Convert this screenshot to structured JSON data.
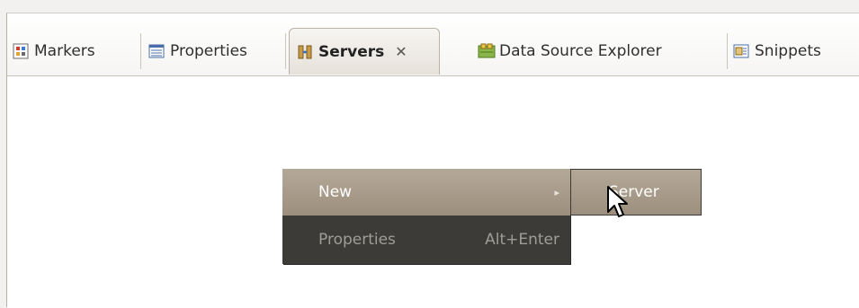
{
  "tabs": [
    {
      "label": "Markers",
      "icon": "markers-icon"
    },
    {
      "label": "Properties",
      "icon": "properties-icon"
    },
    {
      "label": "Servers",
      "icon": "servers-icon",
      "active": true,
      "close": "✕"
    },
    {
      "label": "Data Source Explorer",
      "icon": "data-source-explorer-icon"
    },
    {
      "label": "Snippets",
      "icon": "snippets-icon"
    }
  ],
  "context_menu": {
    "items": [
      {
        "label": "New",
        "arrow": "▸",
        "highlighted": true
      },
      {
        "label": "Properties",
        "shortcut": "Alt+Enter",
        "highlighted": false
      }
    ]
  },
  "submenu": {
    "items": [
      {
        "label": "Server",
        "highlighted": true
      }
    ]
  },
  "colors": {
    "menu_bg": "#3c3b37",
    "menu_highlight": "#a89a88",
    "menu_disabled_text": "#9f9d98"
  }
}
